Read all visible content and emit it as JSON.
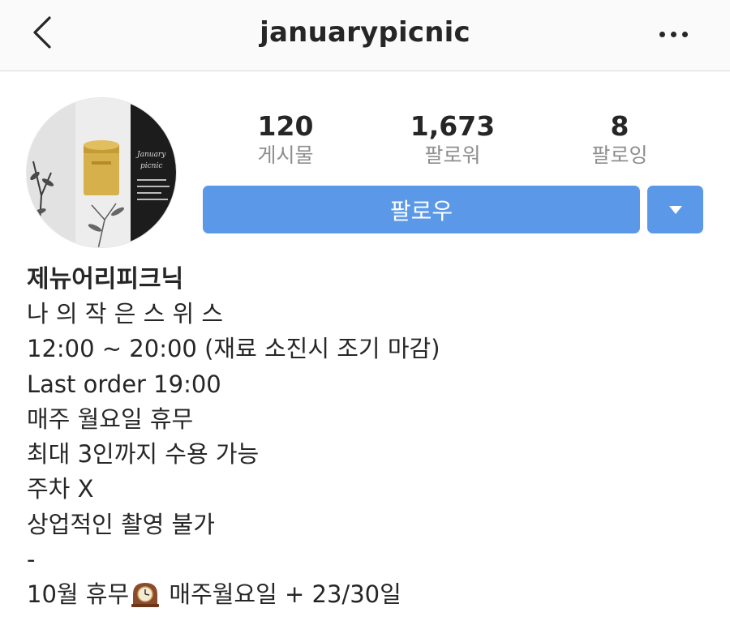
{
  "header": {
    "title": "januarypicnic"
  },
  "profile": {
    "avatar_icon": "profile-photo",
    "avatar_text": [
      "January",
      "picnic"
    ],
    "stats": [
      {
        "value": "120",
        "label": "게시물"
      },
      {
        "value": "1,673",
        "label": "팔로워"
      },
      {
        "value": "8",
        "label": "팔로잉"
      }
    ],
    "follow_label": "팔로우"
  },
  "bio": {
    "name": "제뉴어리피크닉",
    "lines": [
      "나 의 작 은 스 위 스",
      "12:00 ~ 20:00 (재료 소진시 조기 마감)",
      "Last order 19:00",
      "매주 월요일 휴무",
      "최대 3인까지 수용 가능",
      "주차 X",
      "상업적인 촬영 불가",
      "-"
    ],
    "last_line_before": "10월 휴무",
    "last_line_after": " 매주월요일 + 23/30일"
  },
  "colors": {
    "accent": "#5b99e8",
    "muted": "#8e8e8e",
    "text": "#262626"
  }
}
